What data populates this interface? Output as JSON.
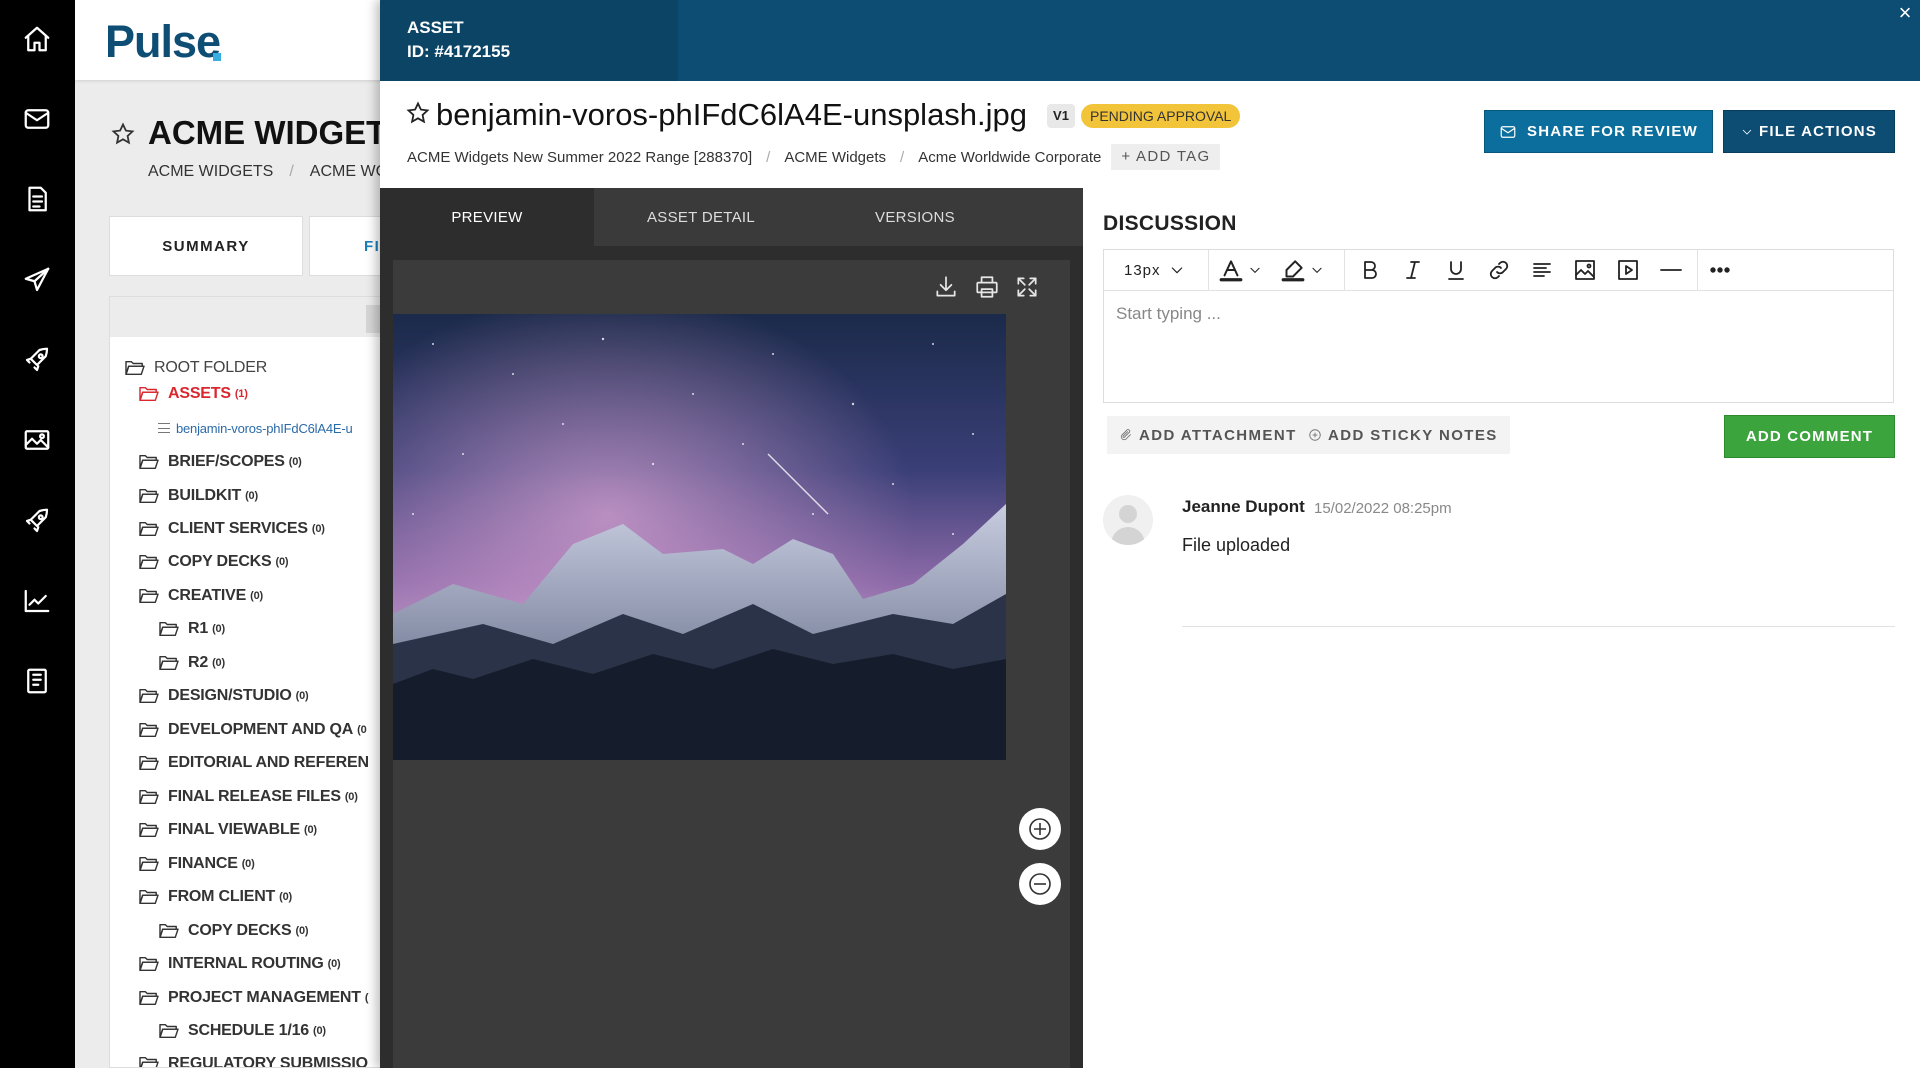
{
  "nav": {
    "icons": [
      "home-icon",
      "mail-icon",
      "document-icon",
      "send-icon",
      "rocket-icon",
      "image-icon",
      "rocket-icon",
      "chart-icon",
      "book-icon"
    ]
  },
  "background": {
    "logo": "Pulse",
    "title": "ACME WIDGETS",
    "breadcrumb": [
      "ACME WIDGETS",
      "ACME WC"
    ],
    "tabs": [
      "SUMMARY",
      "FI"
    ],
    "tree": [
      {
        "label": "ROOT FOLDER",
        "count": ""
      },
      {
        "label": "ASSETS",
        "count": "(1)"
      },
      {
        "label": "benjamin-voros-phIFdC6lA4E-u",
        "count": ""
      },
      {
        "label": "BRIEF/SCOPES",
        "count": "(0)"
      },
      {
        "label": "BUILDKIT",
        "count": "(0)"
      },
      {
        "label": "CLIENT SERVICES",
        "count": "(0)"
      },
      {
        "label": "COPY DECKS",
        "count": "(0)"
      },
      {
        "label": "CREATIVE",
        "count": "(0)"
      },
      {
        "label": "R1",
        "count": "(0)"
      },
      {
        "label": "R2",
        "count": "(0)"
      },
      {
        "label": "DESIGN/STUDIO",
        "count": "(0)"
      },
      {
        "label": "DEVELOPMENT AND QA",
        "count": "(0"
      },
      {
        "label": "EDITORIAL AND REFEREN",
        "count": ""
      },
      {
        "label": "FINAL RELEASE FILES",
        "count": "(0)"
      },
      {
        "label": "FINAL VIEWABLE",
        "count": "(0)"
      },
      {
        "label": "FINANCE",
        "count": "(0)"
      },
      {
        "label": "FROM CLIENT",
        "count": "(0)"
      },
      {
        "label": "COPY DECKS",
        "count": "(0)"
      },
      {
        "label": "INTERNAL ROUTING",
        "count": "(0)"
      },
      {
        "label": "PROJECT MANAGEMENT",
        "count": "("
      },
      {
        "label": "SCHEDULE 1/16",
        "count": "(0)"
      },
      {
        "label": "REGULATORY SUBMISSIO",
        "count": ""
      }
    ]
  },
  "modal": {
    "header": {
      "type": "ASSET",
      "id": "ID: #4172155",
      "close": "×"
    },
    "file_name": "benjamin-voros-phIFdC6lA4E-unsplash.jpg",
    "version": "V1",
    "status": "PENDING APPROVAL",
    "status_color": "#f2c43a",
    "breadcrumbs": [
      "ACME Widgets New Summer 2022 Range [288370]",
      "ACME Widgets",
      "Acme Worldwide Corporate"
    ],
    "add_tag": "+ ADD TAG",
    "share_button": "SHARE FOR REVIEW",
    "file_actions_button": "FILE ACTIONS",
    "share_color": "#0b6e9c",
    "file_actions_color": "#0d4d74",
    "viewer_tabs": [
      "PREVIEW",
      "ASSET DETAIL",
      "VERSIONS"
    ],
    "viewer_tools": [
      "download-icon",
      "print-icon",
      "fullscreen-icon"
    ],
    "zoom": [
      "zoom-in-icon",
      "zoom-out-icon"
    ]
  },
  "discussion": {
    "title": "DISCUSSION",
    "font_size": "13px",
    "placeholder": "Start typing ...",
    "add_attachments": "ADD ATTACHMENTS",
    "add_sticky_notes": "ADD STICKY NOTES",
    "add_comment": "ADD COMMENT",
    "add_comment_color": "#3ca43c",
    "comments": [
      {
        "author": "Jeanne Dupont",
        "time": "15/02/2022 08:25pm",
        "text": "File uploaded"
      }
    ]
  }
}
